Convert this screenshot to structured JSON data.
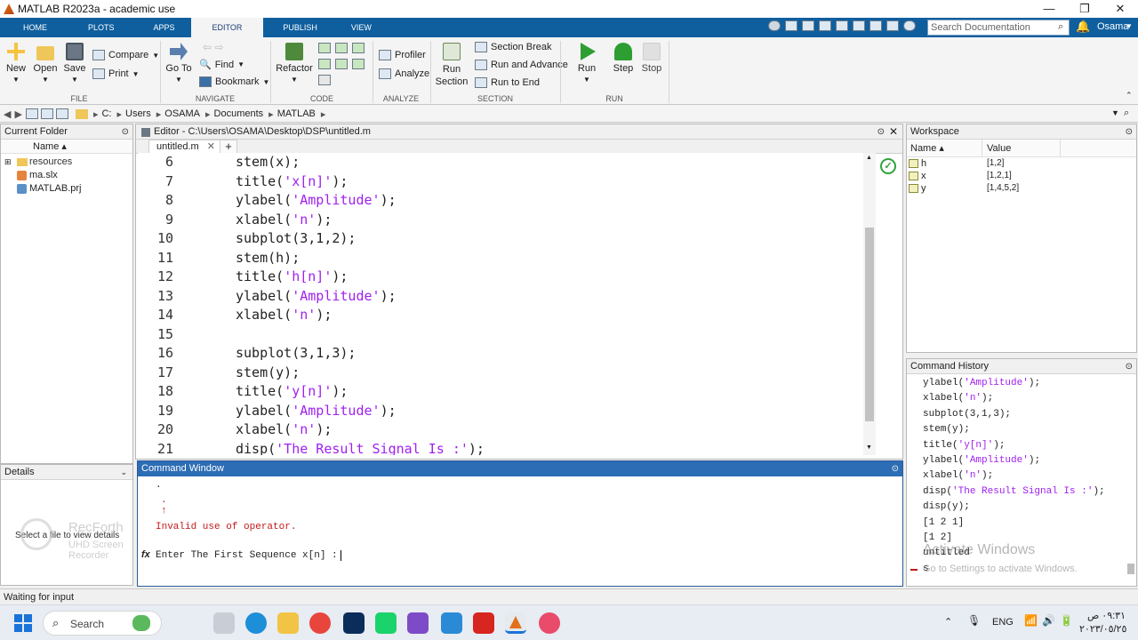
{
  "app": {
    "title": "MATLAB R2023a - academic use",
    "min": "—",
    "max": "❐",
    "close": "✕"
  },
  "ribbon": {
    "tabs": [
      "HOME",
      "PLOTS",
      "APPS",
      "EDITOR",
      "PUBLISH",
      "VIEW"
    ],
    "active_tab": "EDITOR",
    "search_placeholder": "Search Documentation",
    "user": "Osama",
    "file": {
      "new": "New",
      "open": "Open",
      "save": "Save",
      "compare": "Compare",
      "print": "Print",
      "label": "FILE"
    },
    "navigate": {
      "goto": "Go To",
      "find": "Find",
      "bookmark": "Bookmark",
      "label": "NAVIGATE"
    },
    "code": {
      "refactor": "Refactor",
      "label": "CODE"
    },
    "analyze": {
      "profiler": "Profiler",
      "analyze": "Analyze",
      "label": "ANALYZE"
    },
    "section": {
      "run_section": "Run Section",
      "section_break": "Section Break",
      "run_and_advance": "Run and Advance",
      "run_to_end": "Run to End",
      "label": "SECTION"
    },
    "run": {
      "run": "Run",
      "step": "Step",
      "stop": "Stop",
      "label": "RUN"
    }
  },
  "address": {
    "drive": "C:",
    "parts": [
      "Users",
      "OSAMA",
      "Documents",
      "MATLAB"
    ]
  },
  "current_folder": {
    "title": "Current Folder",
    "col": "Name ▴",
    "items": [
      {
        "name": "resources"
      },
      {
        "name": "ma.slx"
      },
      {
        "name": "MATLAB.prj"
      }
    ]
  },
  "details": {
    "title": "Details",
    "hint": "Select a file to view details"
  },
  "editor": {
    "title": "Editor - C:\\Users\\OSAMA\\Desktop\\DSP\\untitled.m",
    "tab": "untitled.m",
    "lines": [
      {
        "n": "6",
        "pre": "stem(x);",
        "str": "",
        "post": ""
      },
      {
        "n": "7",
        "pre": "title(",
        "str": "'x[n]'",
        "post": ");"
      },
      {
        "n": "8",
        "pre": "ylabel(",
        "str": "'Amplitude'",
        "post": ");"
      },
      {
        "n": "9",
        "pre": "xlabel(",
        "str": "'n'",
        "post": ");"
      },
      {
        "n": "10",
        "pre": "subplot(3,1,2);",
        "str": "",
        "post": ""
      },
      {
        "n": "11",
        "pre": "stem(h);",
        "str": "",
        "post": ""
      },
      {
        "n": "12",
        "pre": "title(",
        "str": "'h[n]'",
        "post": ");"
      },
      {
        "n": "13",
        "pre": "ylabel(",
        "str": "'Amplitude'",
        "post": ");"
      },
      {
        "n": "14",
        "pre": "xlabel(",
        "str": "'n'",
        "post": ");"
      },
      {
        "n": "15",
        "pre": "",
        "str": "",
        "post": ""
      },
      {
        "n": "16",
        "pre": "subplot(3,1,3);",
        "str": "",
        "post": ""
      },
      {
        "n": "17",
        "pre": "stem(y);",
        "str": "",
        "post": ""
      },
      {
        "n": "18",
        "pre": "title(",
        "str": "'y[n]'",
        "post": ");"
      },
      {
        "n": "19",
        "pre": "ylabel(",
        "str": "'Amplitude'",
        "post": ");"
      },
      {
        "n": "20",
        "pre": "xlabel(",
        "str": "'n'",
        "post": ");"
      },
      {
        "n": "21",
        "pre": "disp(",
        "str": "'The Result Signal Is :'",
        "post": ");"
      }
    ]
  },
  "command_window": {
    "title": "Command Window",
    "dot1": ".",
    "dot2": ".",
    "caret": "↑",
    "error": "Invalid use of operator.",
    "prompt": "Enter The First Sequence x[n] :",
    "fx": "fx"
  },
  "workspace": {
    "title": "Workspace",
    "col_name": "Name ▴",
    "col_value": "Value",
    "vars": [
      {
        "name": "h",
        "value": "[1,2]"
      },
      {
        "name": "x",
        "value": "[1,2,1]"
      },
      {
        "name": "y",
        "value": "[1,4,5,2]"
      }
    ]
  },
  "history": {
    "title": "Command History",
    "items": [
      {
        "pre": "ylabel(",
        "str": "'Amplitude'",
        "post": ");"
      },
      {
        "pre": "xlabel(",
        "str": "'n'",
        "post": ");"
      },
      {
        "pre": "subplot(3,1,3);",
        "str": "",
        "post": ""
      },
      {
        "pre": "stem(y);",
        "str": "",
        "post": ""
      },
      {
        "pre": "title(",
        "str": "'y[n]'",
        "post": ");"
      },
      {
        "pre": "ylabel(",
        "str": "'Amplitude'",
        "post": ");"
      },
      {
        "pre": "xlabel(",
        "str": "'n'",
        "post": ");"
      },
      {
        "pre": "disp(",
        "str": "'The Result Signal Is :'",
        "post": ");"
      },
      {
        "pre": "disp(y);",
        "str": "",
        "post": ""
      },
      {
        "pre": "[1 2 1]",
        "str": "",
        "post": ""
      },
      {
        "pre": "[1 2]",
        "str": "",
        "post": ""
      },
      {
        "pre": "untitled",
        "str": "",
        "post": ""
      },
      {
        "pre": "s",
        "str": "",
        "post": ""
      }
    ]
  },
  "watermarks": {
    "activate": "Activate Windows",
    "activate_sub": "Go to Settings to activate Windows.",
    "recorder1": "RecForth",
    "recorder2": "UHD Screen Recorder"
  },
  "status": {
    "text": "Waiting for input"
  },
  "taskbar": {
    "search": "Search",
    "lang": "ENG",
    "time": "٠٩:٣١ ص",
    "date": "٢٠٢٣/٠٥/٢٥"
  }
}
